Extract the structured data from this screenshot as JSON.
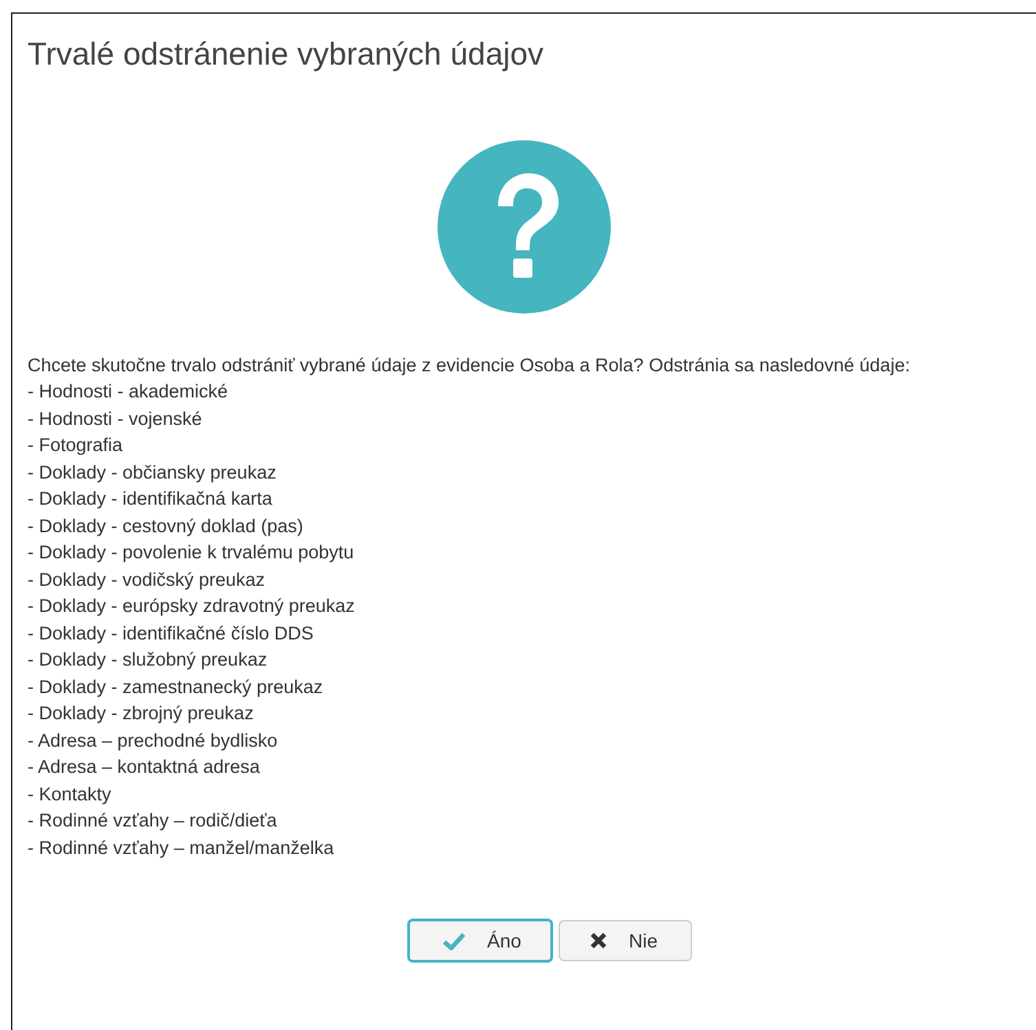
{
  "dialog": {
    "title": "Trvalé odstránenie vybraných údajov",
    "message": "Chcete skutočne trvalo odstrániť vybrané údaje z evidencie Osoba a Rola? Odstránia sa nasledovné údaje:",
    "items": [
      "- Hodnosti - akademické",
      "- Hodnosti - vojenské",
      "- Fotografia",
      "- Doklady - občiansky preukaz",
      "- Doklady - identifikačná karta",
      "- Doklady - cestovný doklad (pas)",
      "- Doklady - povolenie k trvalému pobytu",
      "- Doklady - vodičský preukaz",
      "- Doklady - európsky zdravotný preukaz",
      "- Doklady - identifikačné číslo DDS",
      "- Doklady - služobný preukaz",
      "- Doklady - zamestnanecký preukaz",
      "- Doklady - zbrojný preukaz",
      "- Adresa – prechodné bydlisko",
      "- Adresa – kontaktná adresa",
      "- Kontakty",
      "- Rodinné vzťahy – rodič/dieťa",
      "- Rodinné vzťahy – manžel/manželka"
    ],
    "buttons": [
      {
        "label": "Áno",
        "kind": "confirm",
        "focused": true
      },
      {
        "label": "Nie",
        "kind": "cancel",
        "focused": false
      }
    ]
  }
}
